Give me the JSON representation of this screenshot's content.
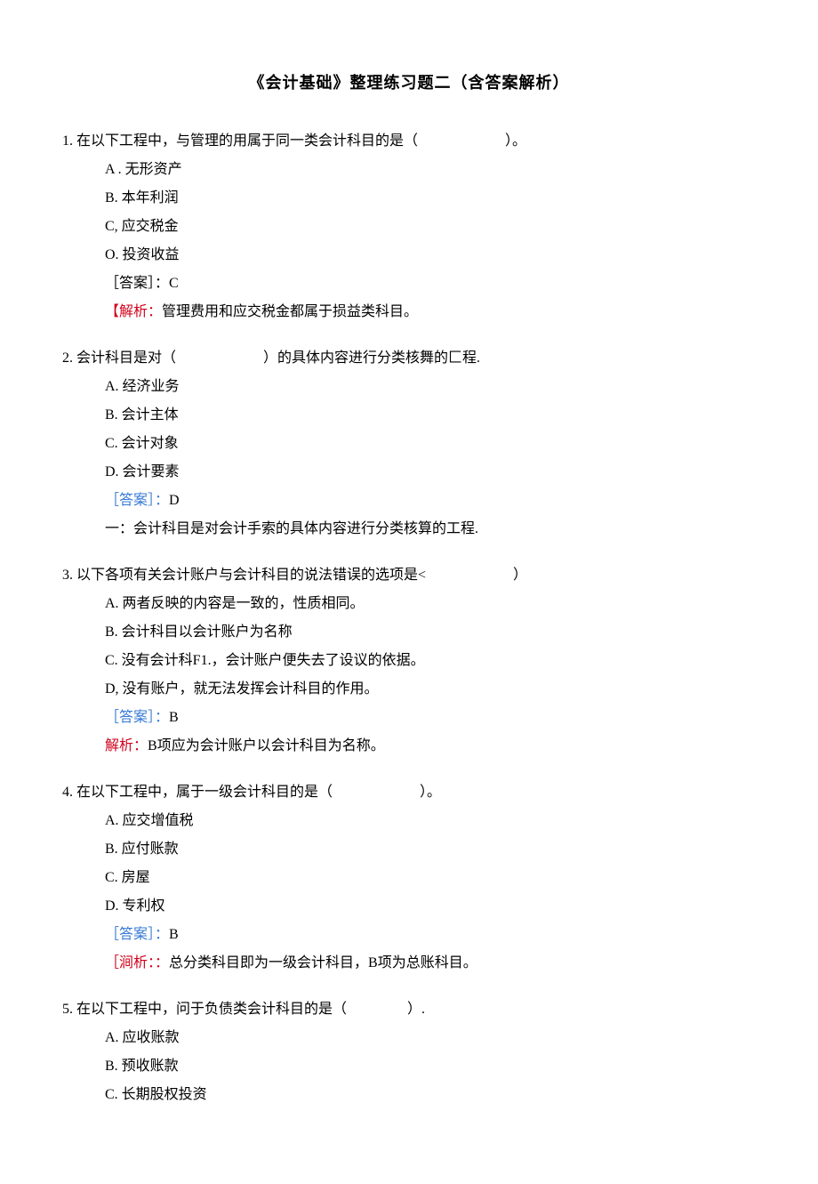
{
  "title": "《会计基础》整理练习题二（含答案解析）",
  "questions": [
    {
      "num": "1.",
      "stem_before": "在以下工程中，与管理的用属于同一类会计科目的是（",
      "stem_after": "）。",
      "options": [
        "A . 无形资产",
        "B. 本年利润",
        "C, 应交税金",
        "O. 投资收益"
      ],
      "answer_label": "［答案］：",
      "answer_value": "C",
      "answer_label_color": "black",
      "analysis_label": "【解析：",
      "analysis_label_color": "red",
      "analysis_text": "管理费用和应交税金都属于损益类科目。"
    },
    {
      "num": "2.",
      "stem_before": "会计科目是对（",
      "stem_after": "）的具体内容进行分类核舞的匚程.",
      "options": [
        "A. 经济业务",
        "B. 会计主体",
        "C. 会计对象",
        "D. 会计要素"
      ],
      "answer_label": "［答案］：",
      "answer_value": "D",
      "answer_label_color": "blue",
      "analysis_label": "一：",
      "analysis_label_color": "black",
      "analysis_text": "会计科目是对会计手索的具体内容进行分类核算的工程."
    },
    {
      "num": "3.",
      "stem_before": "以下各项有关会计账户与会计科目的说法错误的选项是<",
      "stem_after": "）",
      "options": [
        "A. 两者反映的内容是一致的，性质相同。",
        "B. 会计科目以会计账户为名称",
        "C. 没有会计科F1.，会计账户便失去了设议的依据。",
        "D, 没有账户，就无法发挥会计科目的作用。"
      ],
      "answer_label": "［答案］：",
      "answer_value": "B",
      "answer_label_color": "blue",
      "analysis_label": "解析：",
      "analysis_label_color": "red",
      "analysis_text": "B项应为会计账户以会计科目为名称。"
    },
    {
      "num": "4.",
      "stem_before": "在以下工程中，属于一级会计科目的是（",
      "stem_after": "）。",
      "options": [
        "A. 应交增值税",
        "B. 应付账款",
        "C. 房屋",
        "D. 专利权"
      ],
      "answer_label": "［答案］：",
      "answer_value": "B",
      "answer_label_color": "blue",
      "analysis_label": "［涧析：：",
      "analysis_label_color": "red",
      "analysis_text": "总分类科目即为一级会计科目，B项为总账科目。"
    },
    {
      "num": "5.",
      "stem_before": "在以下工程中，问于负债类会计科目的是（",
      "stem_after": "）.",
      "options": [
        "A. 应收账款",
        "B. 预收账款",
        "C. 长期股权投资"
      ],
      "answer_label": "",
      "answer_value": "",
      "answer_label_color": "",
      "analysis_label": "",
      "analysis_label_color": "",
      "analysis_text": ""
    }
  ]
}
